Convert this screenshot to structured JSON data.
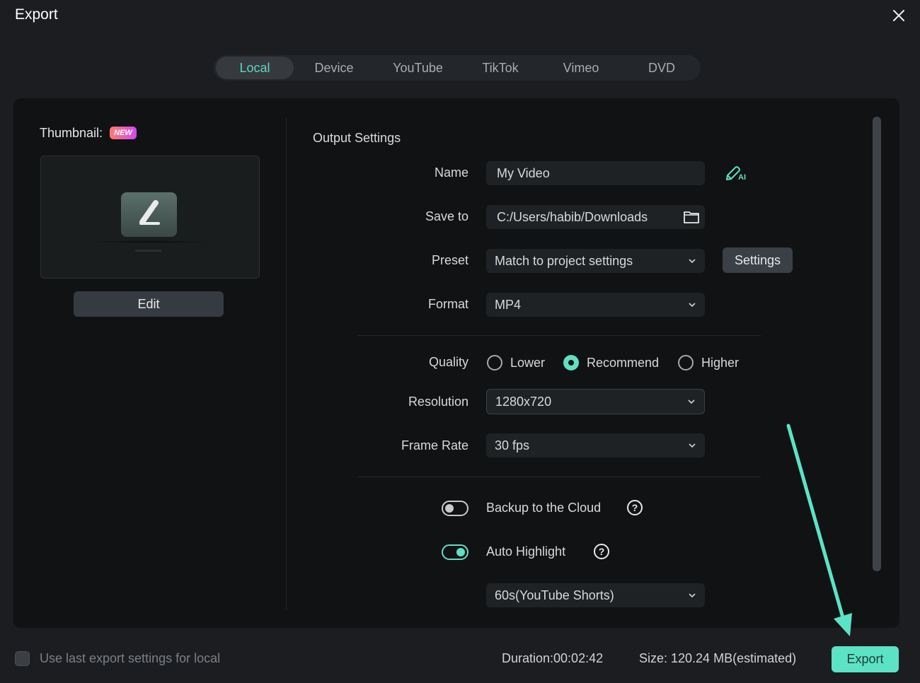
{
  "window": {
    "title": "Export",
    "close_icon": "close-icon"
  },
  "tabs": [
    {
      "label": "Local",
      "active": true
    },
    {
      "label": "Device",
      "active": false
    },
    {
      "label": "YouTube",
      "active": false
    },
    {
      "label": "TikTok",
      "active": false
    },
    {
      "label": "Vimeo",
      "active": false
    },
    {
      "label": "DVD",
      "active": false
    }
  ],
  "thumbnail": {
    "label": "Thumbnail:",
    "badge": "NEW",
    "icon": "pencil-edit-icon",
    "edit_label": "Edit"
  },
  "output": {
    "section_title": "Output Settings",
    "name": {
      "label": "Name",
      "value": "My Video",
      "ai_icon": "ai-pencil-icon"
    },
    "save_to": {
      "label": "Save to",
      "value": "C:/Users/habib/Downloads",
      "icon": "folder-icon"
    },
    "preset": {
      "label": "Preset",
      "value": "Match to project settings",
      "settings_label": "Settings"
    },
    "format": {
      "label": "Format",
      "value": "MP4"
    },
    "quality": {
      "label": "Quality",
      "options": [
        {
          "label": "Lower",
          "checked": false
        },
        {
          "label": "Recommend",
          "checked": true
        },
        {
          "label": "Higher",
          "checked": false
        }
      ]
    },
    "resolution": {
      "label": "Resolution",
      "value": "1280x720"
    },
    "frame_rate": {
      "label": "Frame Rate",
      "value": "30 fps"
    },
    "backup": {
      "label": "Backup to the Cloud",
      "enabled": false,
      "help": "?"
    },
    "auto_highlight": {
      "label": "Auto Highlight",
      "enabled": true,
      "help": "?",
      "duration_value": "60s(YouTube Shorts)"
    }
  },
  "footer": {
    "use_last_label": "Use last export settings for local",
    "use_last_checked": false,
    "duration": "Duration:00:02:42",
    "size": "Size: 120.24 MB(estimated)",
    "export_label": "Export"
  },
  "colors": {
    "accent": "#5ce3c6",
    "background": "#1b1d20",
    "panel": "#111213",
    "badge_start": "#ff7a6b",
    "badge_end": "#d448f5"
  }
}
